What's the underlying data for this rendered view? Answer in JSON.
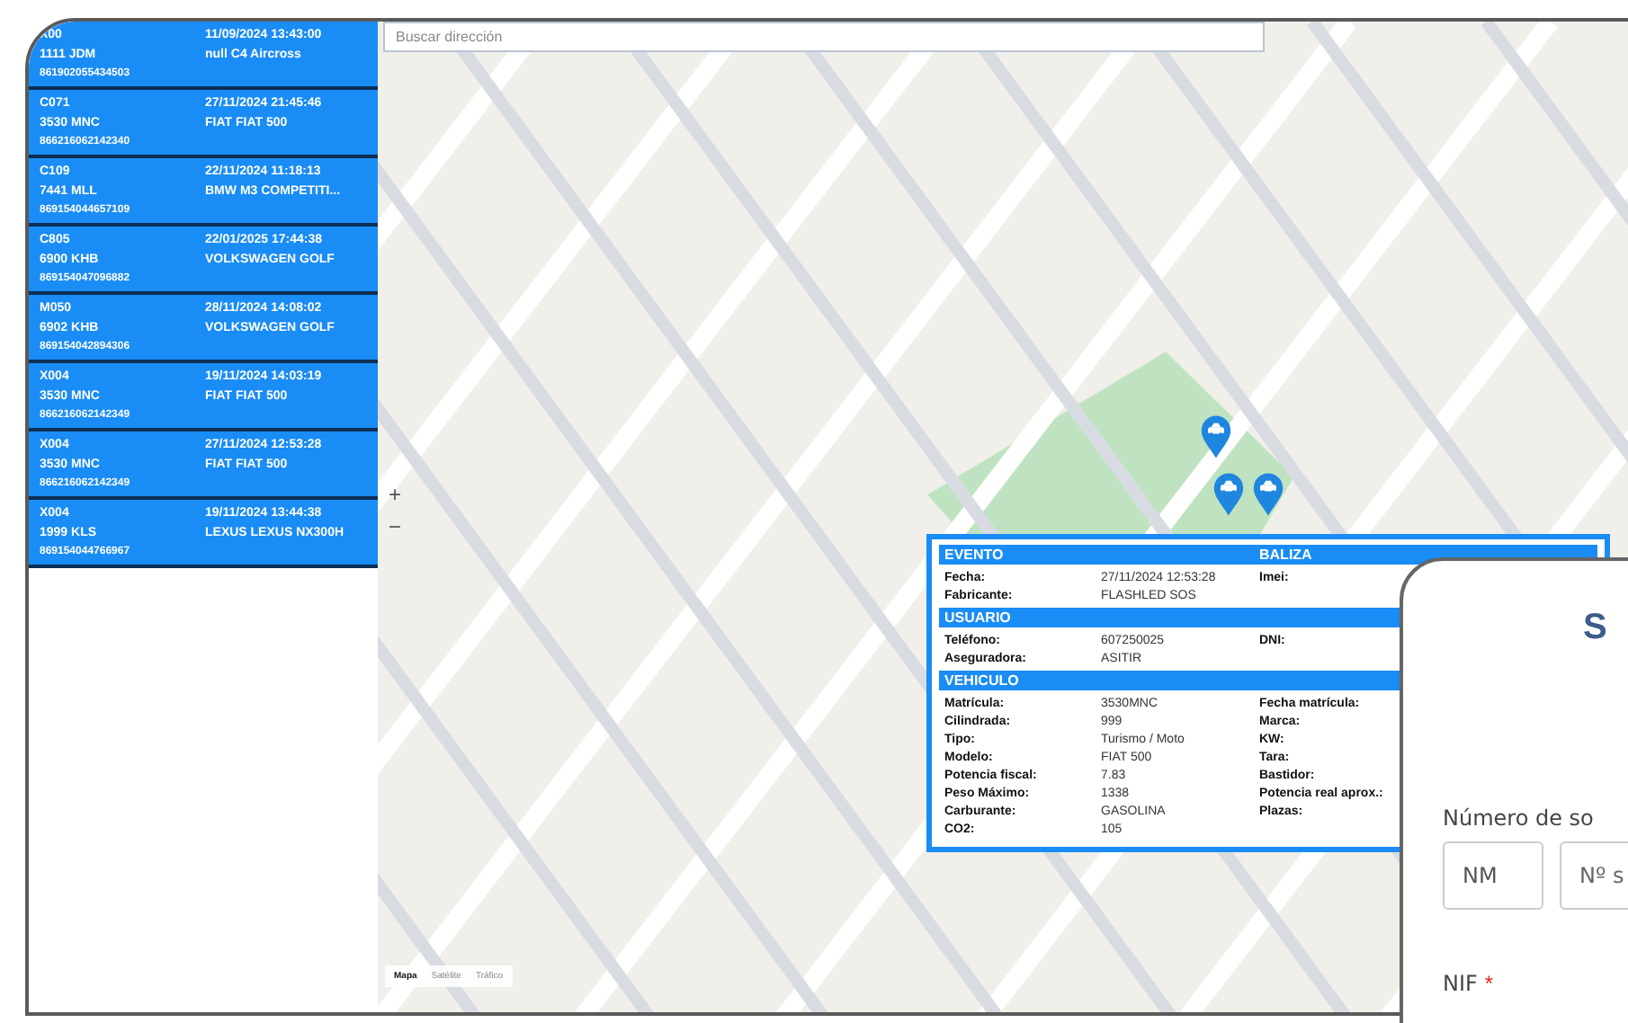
{
  "vehicle_list": [
    {
      "code": "X00",
      "plate": "1111 JDM",
      "imei": "861902055434503",
      "date": "11/09/2024 13:43:00",
      "model": "null C4 Aircross"
    },
    {
      "code": "C071",
      "plate": "3530 MNC",
      "imei": "866216062142340",
      "date": "27/11/2024 21:45:46",
      "model": "FIAT FIAT 500"
    },
    {
      "code": "C109",
      "plate": "7441 MLL",
      "imei": "869154044657109",
      "date": "22/11/2024 11:18:13",
      "model": "BMW M3 COMPETITI..."
    },
    {
      "code": "C805",
      "plate": "6900 KHB",
      "imei": "869154047096882",
      "date": "22/01/2025 17:44:38",
      "model": "VOLKSWAGEN GOLF"
    },
    {
      "code": "M050",
      "plate": "6902 KHB",
      "imei": "869154042894306",
      "date": "28/11/2024 14:08:02",
      "model": "VOLKSWAGEN GOLF"
    },
    {
      "code": "X004",
      "plate": "3530 MNC",
      "imei": "866216062142349",
      "date": "19/11/2024 14:03:19",
      "model": "FIAT FIAT 500"
    },
    {
      "code": "X004",
      "plate": "3530 MNC",
      "imei": "866216062142349",
      "date": "27/11/2024 12:53:28",
      "model": "FIAT FIAT 500"
    },
    {
      "code": "X004",
      "plate": "1999 KLS",
      "imei": "869154044766967",
      "date": "19/11/2024 13:44:38",
      "model": "LEXUS LEXUS NX300H"
    }
  ],
  "map": {
    "search": {
      "placeholder": "Buscar dirección"
    },
    "zoom_controls": [
      "+",
      "−"
    ],
    "map_types": [
      {
        "label": "Mapa",
        "selected": true
      },
      {
        "label": "Satélite",
        "selected": false
      },
      {
        "label": "Tráfico",
        "selected": false
      }
    ],
    "pins": [
      {
        "kind": "car"
      },
      {
        "kind": "car"
      },
      {
        "kind": "car"
      }
    ]
  },
  "event_popup": {
    "sections": [
      {
        "title": "EVENTO",
        "side_title": "BALIZA",
        "rows": [
          {
            "label": "Fecha:",
            "value": "27/11/2024 12:53:28",
            "label_2": "Imei:"
          },
          {
            "label": "Fabricante:",
            "value": "FLASHLED SOS"
          }
        ]
      },
      {
        "title": "USUARIO",
        "rows": [
          {
            "label": "Teléfono:",
            "value": "607250025",
            "label_2": "DNI:"
          },
          {
            "label": "Aseguradora:",
            "value": "ASITIR"
          }
        ]
      },
      {
        "title": "VEHICULO",
        "rows": [
          {
            "label": "Matrícula:",
            "value": "3530MNC",
            "label_2": "Fecha matrícula:"
          },
          {
            "label": "Cilindrada:",
            "value": "999",
            "label_2": "Marca:"
          },
          {
            "label": "Tipo:",
            "value": "Turismo / Moto",
            "label_2": "KW:"
          },
          {
            "label": "Modelo:",
            "value": "FIAT 500",
            "label_2": "Tara:"
          },
          {
            "label": "Potencia fiscal:",
            "value": "7.83",
            "label_2": "Bastidor:"
          },
          {
            "label": "Peso Máximo:",
            "value": "1338",
            "label_2": "Potencia real aprox.:"
          },
          {
            "label": "Carburante:",
            "value": "GASOLINA",
            "label_2": "Plazas:"
          },
          {
            "label": "CO2:",
            "value": "105"
          }
        ]
      }
    ]
  },
  "form_card": {
    "title": "S",
    "fields": [
      {
        "label": "Número de so",
        "inputs": [
          {
            "value": "NM"
          },
          {
            "placeholder": "Nº s"
          }
        ]
      },
      {
        "label": "NIF",
        "required_mark": "*"
      }
    ]
  }
}
